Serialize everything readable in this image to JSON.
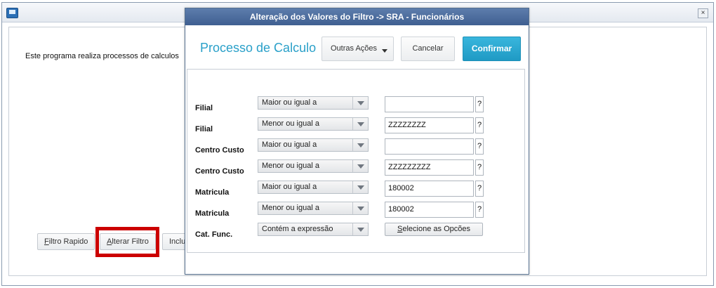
{
  "window": {
    "description": "Este programa realiza processos de calculos",
    "close_glyph": "×",
    "buttons": {
      "filtro_rapido": {
        "first": "F",
        "rest": "iltro Rapido"
      },
      "alterar_filtro": {
        "first": "A",
        "rest": "lterar Filtro"
      },
      "incluir_partial": "Inclui"
    }
  },
  "dialog": {
    "title": "Alteração dos Valores do Filtro -> SRA - Funcionários",
    "heading": "Processo de Calculo",
    "outras_acoes": "Outras Ações",
    "cancelar": "Cancelar",
    "confirmar": "Confirmar",
    "help_glyph": "?",
    "rows": [
      {
        "label": "Filial",
        "condition": "Maior ou igual a",
        "value": ""
      },
      {
        "label": "Filial",
        "condition": "Menor ou igual a",
        "value": "ZZZZZZZZ"
      },
      {
        "label": "Centro Custo",
        "condition": "Maior ou igual a",
        "value": ""
      },
      {
        "label": "Centro Custo",
        "condition": "Menor ou igual a",
        "value": "ZZZZZZZZZ"
      },
      {
        "label": "Matricula",
        "condition": "Maior ou igual a",
        "value": "180002"
      },
      {
        "label": "Matricula",
        "condition": "Menor ou igual a",
        "value": "180002"
      },
      {
        "label": "Cat. Func.",
        "condition": "Contém a expressão",
        "value": ""
      }
    ],
    "selecione": {
      "first": "S",
      "rest": "elecione as Opcões"
    }
  },
  "colors": {
    "dialog_title_bg": "#4b6b9c",
    "heading": "#2aa0c9",
    "confirm_bg": "#29a8d1",
    "highlight": "#cc0000"
  },
  "icons": [
    "window-app-icon",
    "close-icon",
    "dropdown-arrow-icon"
  ]
}
